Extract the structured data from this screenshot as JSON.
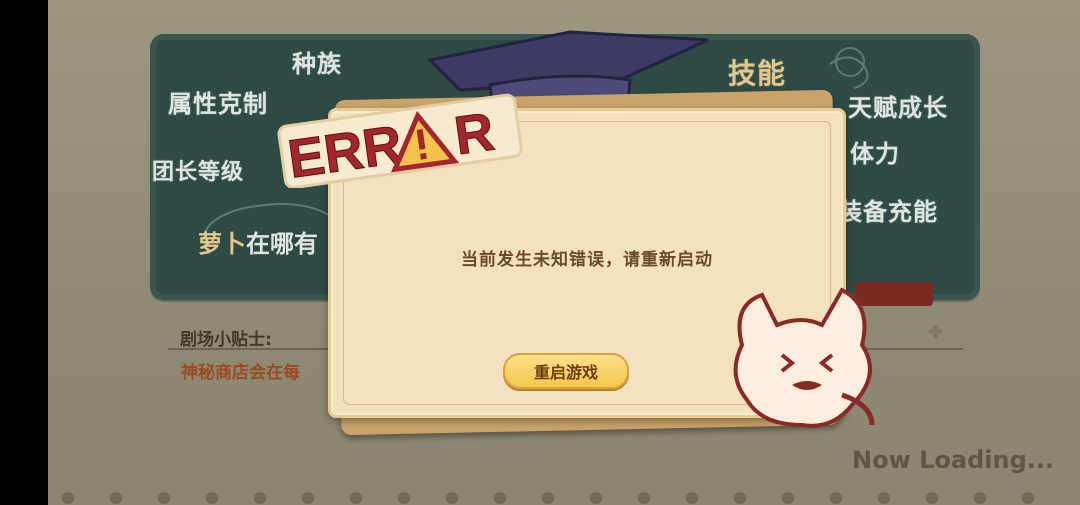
{
  "chalkboard": {
    "labels": [
      "种族",
      "属性克制",
      "团长等级",
      "技能",
      "天赋成长",
      "体力",
      "装备充能"
    ],
    "partial_title_gold": "萝卜",
    "partial_title_white": "在哪有"
  },
  "error_logo": "ERROR",
  "dialog": {
    "message": "当前发生未知错误，请重新启动",
    "restart_label": "重启游戏"
  },
  "hint": {
    "title": "剧场小贴士:",
    "text": "神秘商店会在每"
  },
  "loading_text": "Now Loading..."
}
